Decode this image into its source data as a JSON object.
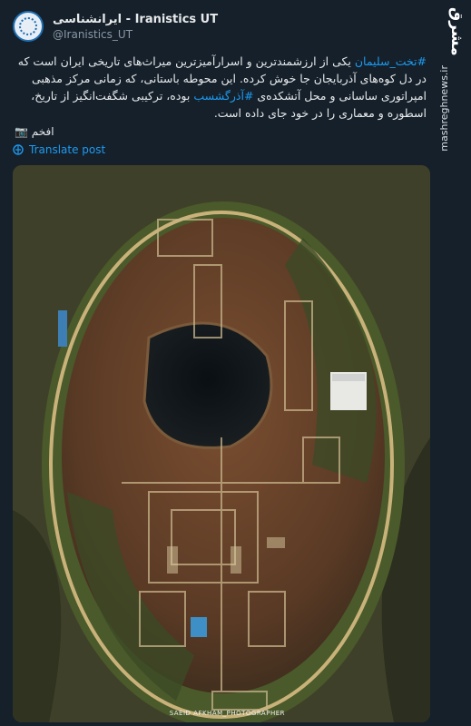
{
  "account": {
    "name": "ایرانشناسی - Iranistics UT",
    "handle": "@Iranistics_UT"
  },
  "watermark": {
    "logo": "مشرق",
    "site": "mashreghnews.ir"
  },
  "post": {
    "hashtag1": "#تخت_سلیمان",
    "text1": " یکی از ارزشمندترین و اسرارآمیزترین میراث‌های تاریخی ایران است که در دل کوه‌های آذربایجان جا خوش کرده. این محوطه باستانی، که زمانی مرکز مذهبی امپراتوری ساسانی و محل آتشکده‌ی ",
    "hashtag2": "#آذرگشسب",
    "text2": " بوده، ترکیبی شگفت‌انگیز از تاریخ، اسطوره و معماری را در خود جای داده است.",
    "author": "افخم 📷",
    "translate_label": "Translate post"
  },
  "photo": {
    "credit": "SAEID AFKHAM_PHOTOGRAPHER"
  },
  "colors": {
    "background": "#15202b",
    "link": "#1d9bf0",
    "text": "#e7e9ea",
    "muted": "#8b98a5"
  }
}
